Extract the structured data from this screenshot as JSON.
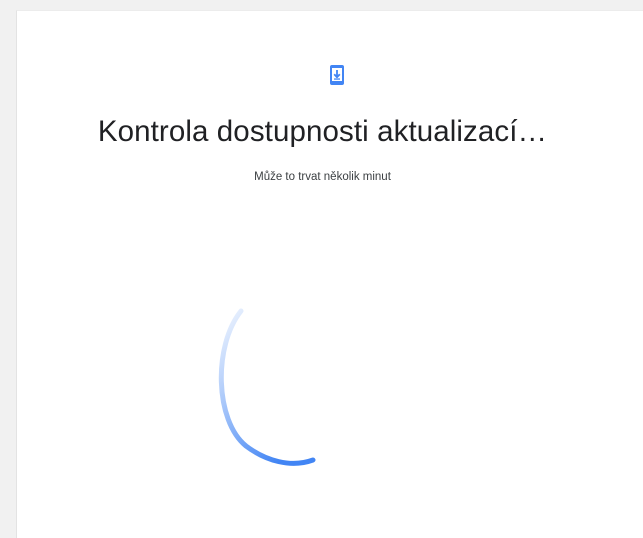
{
  "header": {
    "icon": "phone-download-icon",
    "title": "Kontrola dostupnosti aktualizací…",
    "subtitle": "Může to trvat několik minut"
  },
  "spinner": {
    "icon": "loading-spinner",
    "color": "#4285f4"
  },
  "colors": {
    "accent": "#4285f4",
    "background": "#ffffff"
  }
}
